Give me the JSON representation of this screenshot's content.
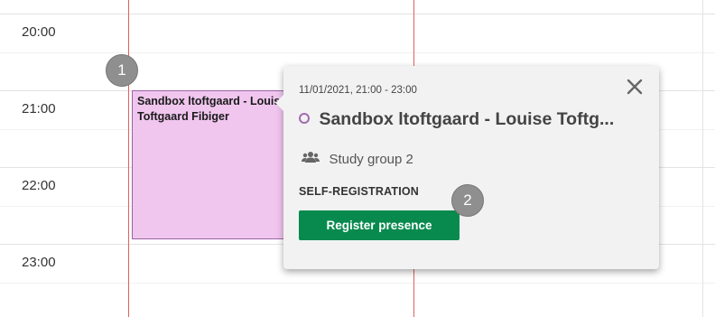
{
  "calendar": {
    "times": [
      "20:00",
      "21:00",
      "22:00",
      "23:00"
    ],
    "colors": {
      "now_line": "#e0605f",
      "grid_line": "#e3e3e3"
    }
  },
  "event": {
    "title": "Sandbox ltoftgaard - Louise Toftgaard Fibiger",
    "fill_color": "#f0c6ee",
    "border_color": "#9a63a8"
  },
  "markers": [
    "1",
    "2"
  ],
  "popover": {
    "datetime": "11/01/2021, 21:00 - 23:00",
    "title": "Sandbox ltoftgaard - Louise Toftg...",
    "group_icon": "users-icon",
    "group": "Study group 2",
    "section_label": "SELF-REGISTRATION",
    "register_label": "Register presence",
    "close_icon": "close-icon",
    "colors": {
      "background": "#f2f2f2",
      "button": "#088a4e",
      "status_circle": "#a36ab0"
    }
  }
}
